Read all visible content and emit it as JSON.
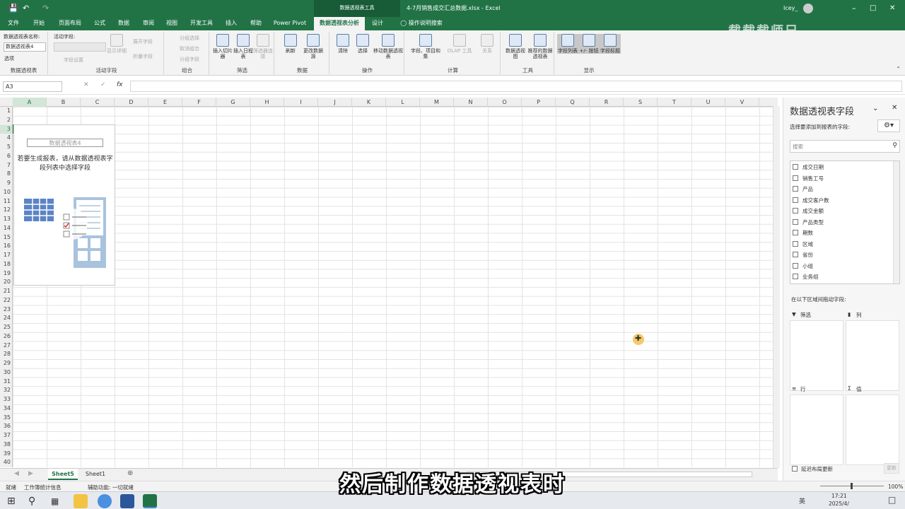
{
  "titlebar": {
    "context_title": "数据透视表工具",
    "file_title": "4-7月销售成交汇总数据.xlsx  -  Excel",
    "user": "Icey_"
  },
  "tabs": [
    "文件",
    "开始",
    "页面布局",
    "公式",
    "数据",
    "审阅",
    "视图",
    "开发工具",
    "插入",
    "帮助",
    "Power Pivot",
    "数据透视表分析",
    "设计",
    "操作说明搜索"
  ],
  "ribbon": {
    "pivot_name_label": "数据透视表名称:",
    "pivot_name_value": "数据透视表4",
    "options_label": "选项",
    "active_field_label": "活动字段:",
    "field_settings": "字段设置",
    "drill_down": "显示详细",
    "expand": "展开字段",
    "collapse": "折叠字段",
    "group_sel": "分组选择",
    "ungroup": "取消组合",
    "group_field": "分组字段",
    "slicer": "插入切片器",
    "timeline": "插入日程表",
    "filter_conn": "筛选器连接",
    "refresh": "刷新",
    "change_source": "更改数据源",
    "clear": "清除",
    "select": "选择",
    "move": "移动数据透视表",
    "fields_items": "字段、项目和集",
    "olap": "OLAP 工具",
    "relations": "关系",
    "pivotchart": "数据透视图",
    "recommended": "推荐的数据透视表",
    "field_list": "字段列表",
    "buttons": "+/- 按钮",
    "headers": "字段标题",
    "groups": [
      "数据透视表",
      "活动字段",
      "组合",
      "筛选",
      "数据",
      "操作",
      "计算",
      "工具",
      "显示"
    ]
  },
  "formula_bar": {
    "name_box": "A3",
    "fx": "fx"
  },
  "columns": [
    "A",
    "B",
    "C",
    "D",
    "E",
    "F",
    "G",
    "H",
    "I",
    "J",
    "K",
    "L",
    "M",
    "N",
    "O",
    "P",
    "Q",
    "R",
    "S",
    "T",
    "U",
    "V"
  ],
  "rows": [
    "1",
    "2",
    "3",
    "4",
    "5",
    "6",
    "7",
    "8",
    "9",
    "10",
    "11",
    "12",
    "13",
    "14",
    "15",
    "16",
    "17",
    "18",
    "19",
    "20",
    "21",
    "22",
    "23",
    "24",
    "25",
    "26",
    "27",
    "28",
    "29",
    "30",
    "31",
    "32",
    "33",
    "34",
    "35",
    "36",
    "37",
    "38",
    "39",
    "40"
  ],
  "pivot_placeholder": {
    "title": "数据透视表4",
    "hint": "若要生成报表，请从数据透视表字段列表中选择字段"
  },
  "sheets": [
    "Sheet5",
    "Sheet1"
  ],
  "statusbar": {
    "ready": "就绪",
    "workbook_stats": "工作簿统计信息",
    "accessibility": "辅助功能: 一切就绪",
    "zoom": "100%"
  },
  "taskbar": {
    "time": "17:21",
    "date": "2025/4/",
    "ime": "英"
  },
  "pane": {
    "title": "数据透视表字段",
    "choose_label": "选择要添加到报表的字段:",
    "search_placeholder": "搜索",
    "fields": [
      "成交日期",
      "销售工号",
      "产品",
      "成交客户数",
      "成交金额",
      "产品类型",
      "期数",
      "区域",
      "省份",
      "小组",
      "业务组"
    ],
    "drag_label": "在以下区域间拖动字段:",
    "filters": "筛选",
    "columns": "列",
    "rows": "行",
    "values": "值",
    "defer": "延迟布局更新",
    "update": "更新"
  },
  "subtitle": "然后制作数据透视表时",
  "watermark": "载载载师兄"
}
